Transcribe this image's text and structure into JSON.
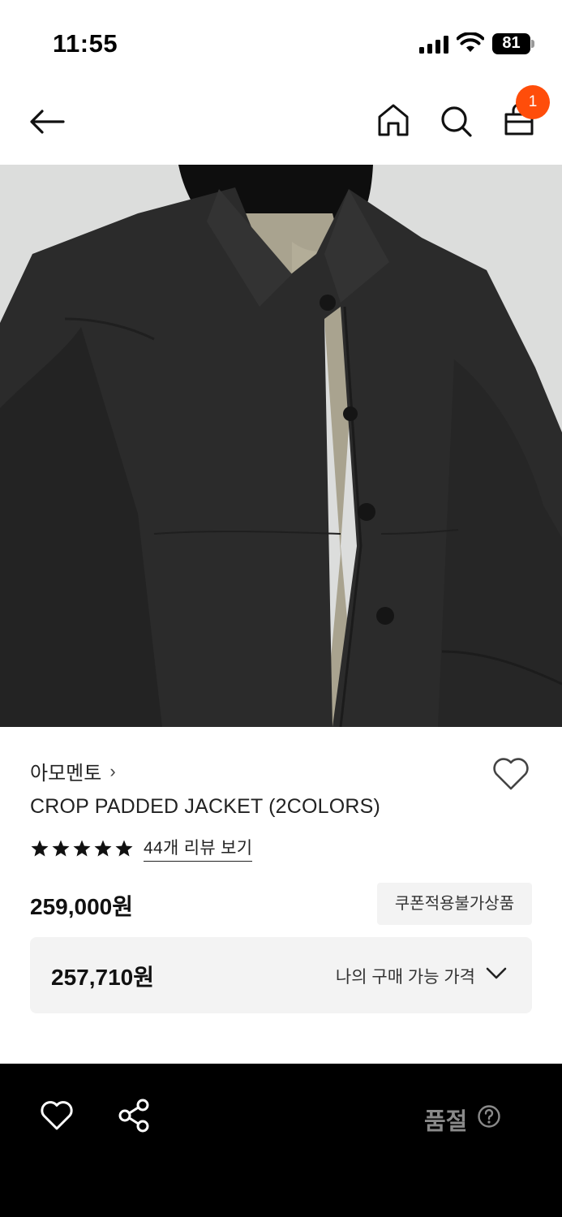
{
  "status_bar": {
    "time": "11:55",
    "battery": "81"
  },
  "nav": {
    "back_icon": "arrow-left-icon",
    "home_icon": "home-icon",
    "search_icon": "search-icon",
    "bag_icon": "shopping-bag-icon",
    "cart_count": "1",
    "badge_color": "#ff4d0a"
  },
  "product": {
    "brand": "아모멘토",
    "brand_chevron": "›",
    "title": "CROP PADDED JACKET (2COLORS)",
    "rating_stars": 5,
    "review_link": "44개 리뷰 보기",
    "price": "259,000원",
    "coupon_note": "쿠폰적용불가상품",
    "my_price": "257,710원",
    "my_price_label": "나의 구매 가능 가격"
  },
  "bottom_bar": {
    "wish_icon": "heart-icon",
    "share_icon": "share-icon",
    "status_label": "품절",
    "help_icon": "question-circle-icon"
  }
}
